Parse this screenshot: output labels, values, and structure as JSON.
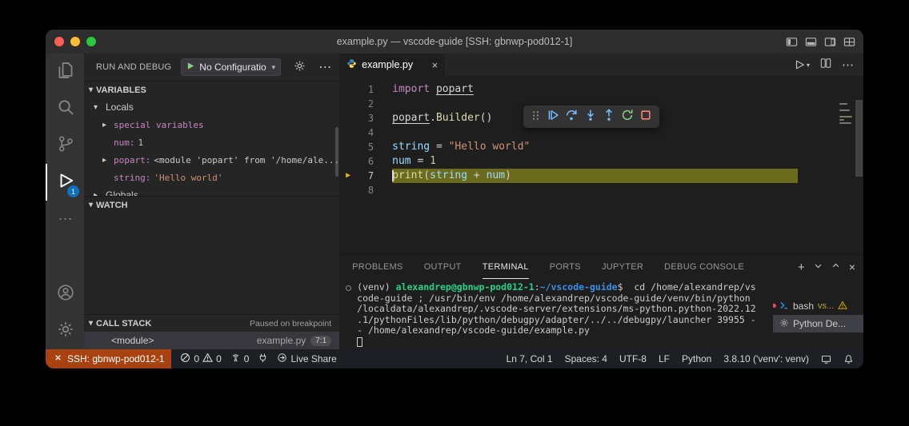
{
  "window": {
    "title": "example.py — vscode-guide [SSH: gbnwp-pod012-1]"
  },
  "run_and_debug": {
    "title": "RUN AND DEBUG",
    "config": "No Configuratio"
  },
  "activity_badge": "1",
  "variables": {
    "header": "VARIABLES",
    "locals": "Locals",
    "rows": [
      {
        "label": "special variables"
      },
      {
        "name": "num:",
        "value": "1"
      },
      {
        "name": "popart:",
        "value": "<module 'popart' from '/home/ale..."
      },
      {
        "name": "string:",
        "value": "'Hello world'"
      },
      {
        "label": "Globals"
      }
    ]
  },
  "watch": {
    "header": "WATCH"
  },
  "call_stack": {
    "header": "CALL STACK",
    "status": "Paused on breakpoint",
    "frame": {
      "name": "<module>",
      "file": "example.py",
      "position": "7:1"
    }
  },
  "editor": {
    "tab": "example.py",
    "lines": [
      {
        "n": "1",
        "tokens": [
          {
            "t": "import",
            "c": "kw"
          },
          {
            "t": " ",
            "c": "pl"
          },
          {
            "t": "popart",
            "c": "mod"
          }
        ]
      },
      {
        "n": "2",
        "tokens": []
      },
      {
        "n": "3",
        "tokens": [
          {
            "t": "popart",
            "c": "mod"
          },
          {
            "t": ".",
            "c": "pl"
          },
          {
            "t": "Builder",
            "c": "fn"
          },
          {
            "t": "()",
            "c": "pl"
          }
        ]
      },
      {
        "n": "4",
        "tokens": []
      },
      {
        "n": "5",
        "tokens": [
          {
            "t": "string",
            "c": "var"
          },
          {
            "t": " = ",
            "c": "pl"
          },
          {
            "t": "\"Hello world\"",
            "c": "str"
          }
        ]
      },
      {
        "n": "6",
        "tokens": [
          {
            "t": "num",
            "c": "var"
          },
          {
            "t": " = ",
            "c": "pl"
          },
          {
            "t": "1",
            "c": "num"
          }
        ]
      },
      {
        "n": "7",
        "current": true,
        "tokens": [
          {
            "t": "print",
            "c": "fn"
          },
          {
            "t": "(",
            "c": "pl"
          },
          {
            "t": "string",
            "c": "var"
          },
          {
            "t": " + ",
            "c": "pl"
          },
          {
            "t": "num",
            "c": "var"
          },
          {
            "t": ")",
            "c": "pl"
          }
        ]
      },
      {
        "n": "8",
        "tokens": []
      }
    ]
  },
  "panel": {
    "tabs": [
      {
        "label": "PROBLEMS"
      },
      {
        "label": "OUTPUT"
      },
      {
        "label": "TERMINAL",
        "active": true
      },
      {
        "label": "PORTS"
      },
      {
        "label": "JUPYTER"
      },
      {
        "label": "DEBUG CONSOLE"
      }
    ],
    "terminal": {
      "prompt": [
        {
          "t": "(venv) ",
          "c": "w"
        },
        {
          "t": "alexandrep@gbnwp-pod012-1",
          "c": "g"
        },
        {
          "t": ":",
          "c": "w"
        },
        {
          "t": "~/vscode-guide",
          "c": "b"
        },
        {
          "t": "$",
          "c": "w"
        },
        {
          "t": "  cd /home/alexandrep/vs",
          "c": "w"
        }
      ],
      "wrapped": [
        "code-guide ; /usr/bin/env /home/alexandrep/vscode-guide/venv/bin/python",
        "/localdata/alexandrep/.vscode-server/extensions/ms-python.python-2022.12",
        ".1/pythonFiles/lib/python/debugpy/adapter/../../debugpy/launcher 39955 -",
        "- /home/alexandrep/vscode-guide/example.py"
      ]
    },
    "terminals": [
      {
        "label": "bash",
        "extra": "vs...",
        "warning": true
      },
      {
        "label": "Python De...",
        "selected": true
      }
    ]
  },
  "status_bar": {
    "remote": "SSH: gbnwp-pod012-1",
    "errors": "0",
    "warnings": "0",
    "tower": "0",
    "live_share": "Live Share",
    "cursor": "Ln 7, Col 1",
    "indent": "Spaces: 4",
    "encoding": "UTF-8",
    "eol": "LF",
    "language": "Python",
    "interpreter": "3.8.10 ('venv': venv)"
  },
  "colors": {
    "remote_bg": "#a84211",
    "badge": "#0e70c0",
    "debug_line_highlight": "#6b6b1d",
    "accent_blue": "#75beff"
  }
}
